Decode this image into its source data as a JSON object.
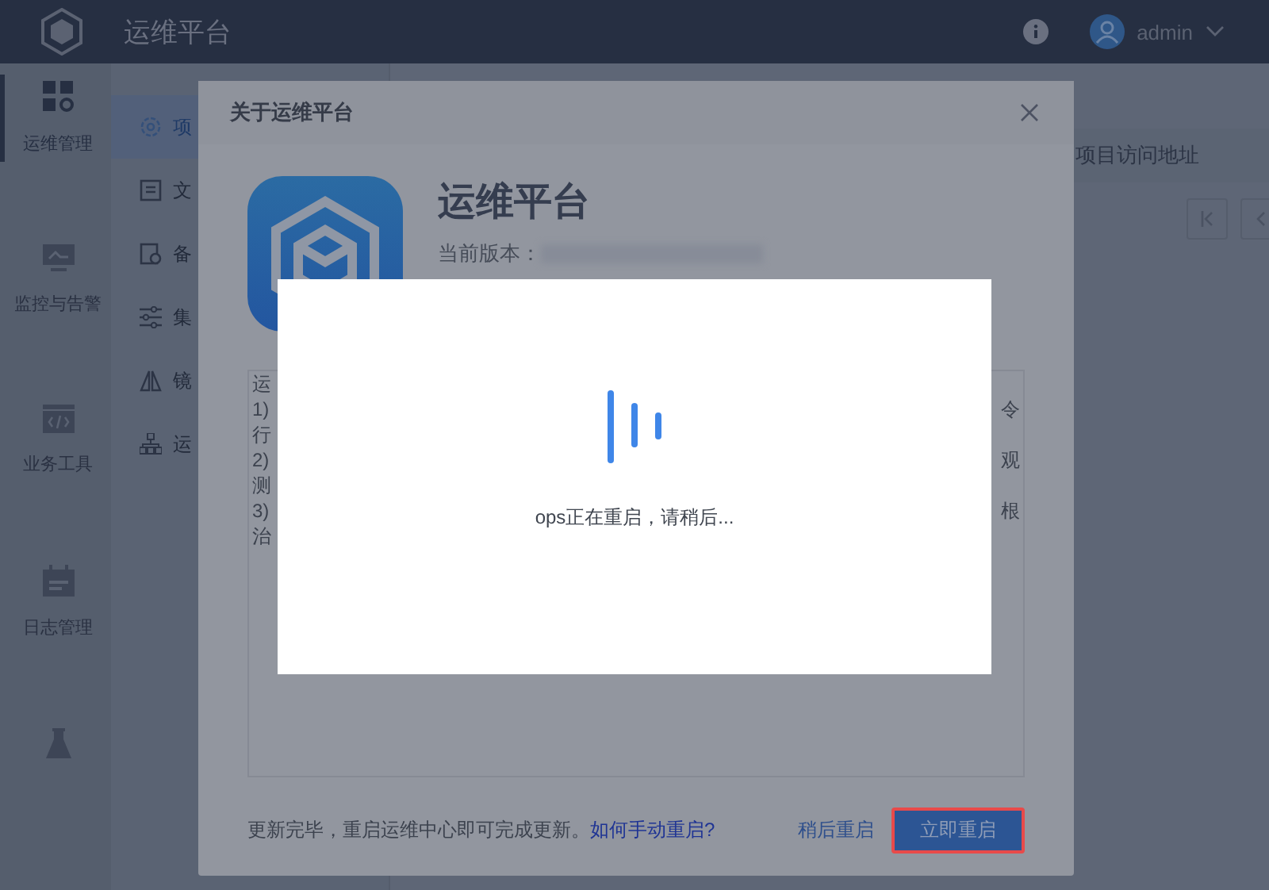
{
  "header": {
    "title": "运维平台",
    "user": "admin"
  },
  "nav": [
    {
      "kind": "grid",
      "label": "运维管理",
      "selected": true
    },
    {
      "kind": "monitor",
      "label": "监控与告警",
      "selected": false
    },
    {
      "kind": "code",
      "label": "业务工具",
      "selected": false
    },
    {
      "kind": "calendar",
      "label": "日志管理",
      "selected": false
    },
    {
      "kind": "flask",
      "selected": false
    }
  ],
  "subnav": [
    {
      "kind": "gear",
      "label": "项",
      "selected": true
    },
    {
      "kind": "doc",
      "label": "文",
      "selected": false
    },
    {
      "kind": "backup",
      "label": "备",
      "selected": false
    },
    {
      "kind": "sliders",
      "label": "集",
      "selected": false
    },
    {
      "kind": "mirror",
      "label": "镜",
      "selected": false
    },
    {
      "kind": "tree",
      "label": "运",
      "selected": false
    }
  ],
  "main": {
    "column_header": "项目访问地址"
  },
  "dialog": {
    "title": "关于运维平台",
    "app_name": "运维平台",
    "version_label": "当前版本：",
    "notes": [
      {
        "left": "运"
      },
      {
        "left": "1)",
        "right": "令"
      },
      {
        "left": "行"
      },
      {
        "left": "2)",
        "right": "观"
      },
      {
        "left": "测"
      },
      {
        "left": "3)",
        "right": "根"
      },
      {
        "left": "治"
      }
    ],
    "footer_text": "更新完毕，重启运维中心即可完成更新。",
    "help_link": "如何手动重启?",
    "buttons": [
      {
        "kind": "link",
        "label": "稍后重启",
        "focused": false
      },
      {
        "kind": "primary",
        "label": "立即重启",
        "focused": true
      }
    ]
  },
  "loading": {
    "message": "ops正在重启，请稍后..."
  }
}
